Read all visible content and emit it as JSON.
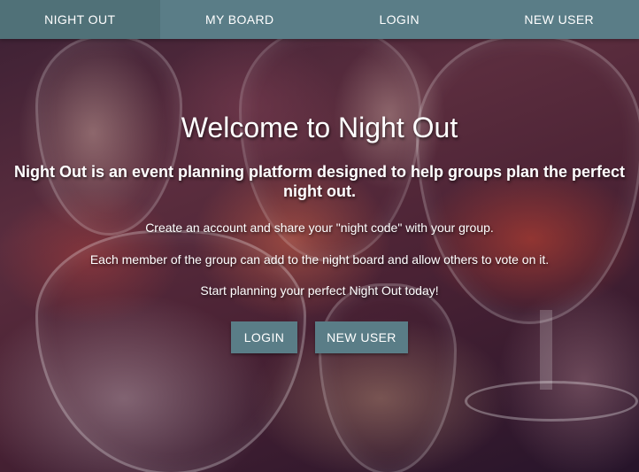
{
  "nav": {
    "items": [
      {
        "label": "NIGHT OUT",
        "active": true
      },
      {
        "label": "MY BOARD",
        "active": false
      },
      {
        "label": "LOGIN",
        "active": false
      },
      {
        "label": "NEW USER",
        "active": false
      }
    ],
    "color": "#5a7d87"
  },
  "hero": {
    "title": "Welcome to Night Out",
    "subtitle": "Night Out is an event planning platform designed to help groups plan the perfect night out.",
    "lines": [
      "Create an account and share your \"night code\" with your group.",
      "Each member of the group can add to the night board and allow others to vote on it.",
      "Start planning your perfect Night Out today!"
    ],
    "buttons": {
      "login_label": "LOGIN",
      "new_user_label": "NEW USER"
    }
  }
}
